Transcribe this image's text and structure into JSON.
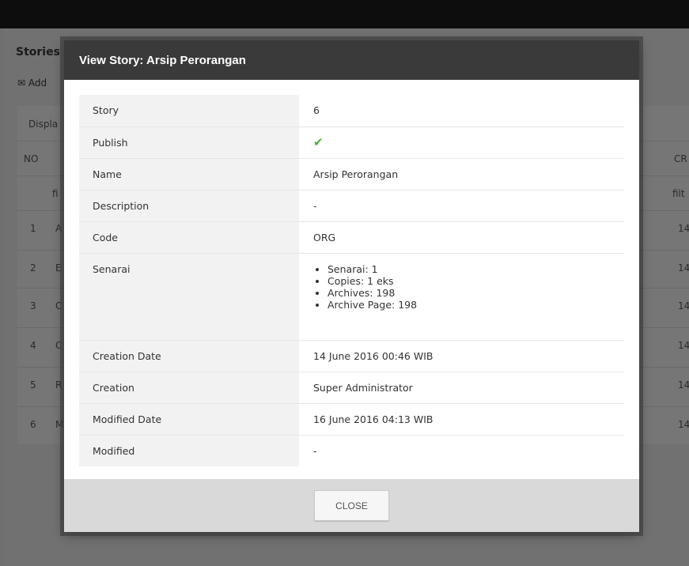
{
  "background": {
    "title": "Stories",
    "add_label": "Add",
    "display_label": "Displa",
    "col_no": "NO",
    "col_cr": "CR",
    "filter_left": "fi",
    "filter_right": "filt",
    "rows": [
      {
        "no": "1",
        "a": "A",
        "cr": "14"
      },
      {
        "no": "2",
        "a": "E",
        "cr": "14"
      },
      {
        "no": "3",
        "a": "C",
        "cr": "14"
      },
      {
        "no": "4",
        "a": "C",
        "cr": "14"
      },
      {
        "no": "5",
        "a": "R",
        "cr": "14"
      },
      {
        "no": "6",
        "a": "M",
        "cr": "14"
      }
    ]
  },
  "modal": {
    "title": "View Story: Arsip Perorangan",
    "fields": [
      {
        "label": "Story",
        "value": "6"
      },
      {
        "label": "Publish",
        "value": ""
      },
      {
        "label": "Name",
        "value": "Arsip Perorangan"
      },
      {
        "label": "Description",
        "value": "-"
      },
      {
        "label": "Code",
        "value": "ORG"
      },
      {
        "label": "Senarai",
        "value": ""
      },
      {
        "label": "Creation Date",
        "value": "14 June 2016 00:46 WIB"
      },
      {
        "label": "Creation",
        "value": "Super Administrator"
      },
      {
        "label": "Modified Date",
        "value": "16 June 2016 04:13 WIB"
      },
      {
        "label": "Modified",
        "value": "-"
      }
    ],
    "senarai_items": [
      "Senarai: 1",
      "Copies: 1 eks",
      "Archives: 198",
      "Archive Page: 198"
    ],
    "close_label": "CLOSE",
    "publish_icon": "check-icon",
    "check_color": "#4caf2f"
  }
}
